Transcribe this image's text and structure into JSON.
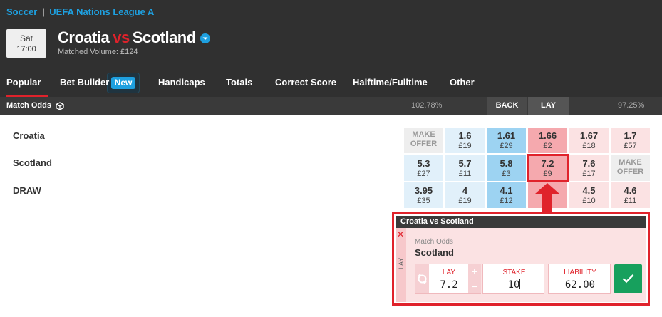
{
  "breadcrumb": {
    "sport": "Soccer",
    "separator": "|",
    "competition": "UEFA Nations League A"
  },
  "event": {
    "day": "Sat",
    "time": "17:00",
    "home": "Croatia",
    "vs": "vs",
    "away": "Scotland",
    "matched_volume": "Matched Volume: £124"
  },
  "tabs": [
    {
      "label": "Popular",
      "active": true
    },
    {
      "label": "Bet Builder"
    },
    {
      "label": "Handicaps"
    },
    {
      "label": "Totals"
    },
    {
      "label": "Correct Score"
    },
    {
      "label": "Halftime/Fulltime"
    },
    {
      "label": "Other"
    }
  ],
  "new_badge": "New",
  "market": {
    "name": "Match Odds",
    "back_overround": "102.78%",
    "back_label": "BACK",
    "lay_label": "LAY",
    "lay_overround": "97.25%"
  },
  "runners": [
    {
      "name": "Croatia",
      "prices": [
        {
          "type": "offer",
          "label1": "MAKE",
          "label2": "OFFER"
        },
        {
          "type": "back-lt",
          "odds": "1.6",
          "amount": "£19"
        },
        {
          "type": "back",
          "odds": "1.61",
          "amount": "£29"
        },
        {
          "type": "lay",
          "odds": "1.66",
          "amount": "£2"
        },
        {
          "type": "lay-lt",
          "odds": "1.67",
          "amount": "£18"
        },
        {
          "type": "lay-lt",
          "odds": "1.7",
          "amount": "£57"
        }
      ]
    },
    {
      "name": "Scotland",
      "prices": [
        {
          "type": "back-lt",
          "odds": "5.3",
          "amount": "£27"
        },
        {
          "type": "back-lt",
          "odds": "5.7",
          "amount": "£11"
        },
        {
          "type": "back",
          "odds": "5.8",
          "amount": "£3"
        },
        {
          "type": "lay",
          "odds": "7.2",
          "amount": "£9"
        },
        {
          "type": "lay-lt",
          "odds": "7.6",
          "amount": "£17"
        },
        {
          "type": "offer",
          "label1": "MAKE",
          "label2": "OFFER"
        }
      ]
    },
    {
      "name": "DRAW",
      "prices": [
        {
          "type": "back-lt",
          "odds": "3.95",
          "amount": "£35"
        },
        {
          "type": "back-lt",
          "odds": "4",
          "amount": "£19"
        },
        {
          "type": "back",
          "odds": "4.1",
          "amount": "£12"
        },
        {
          "type": "lay",
          "odds": "",
          "amount": ""
        },
        {
          "type": "lay-lt",
          "odds": "4.5",
          "amount": "£10"
        },
        {
          "type": "lay-lt",
          "odds": "4.6",
          "amount": "£11"
        }
      ]
    }
  ],
  "betslip": {
    "title": "Croatia vs Scotland",
    "close": "✕",
    "side": "LAY",
    "market": "Match Odds",
    "selection": "Scotland",
    "odds_label": "LAY",
    "odds_value": "7.2",
    "plus": "+",
    "minus": "−",
    "stake_label": "STAKE",
    "stake_value": "10",
    "liability_label": "LIABILITY",
    "liability_value": "62.00"
  },
  "colors": {
    "accent_blue": "#1ea0e0",
    "brand_red": "#e0222b",
    "back": "#9dd3f2",
    "lay": "#f5a9ae",
    "confirm_green": "#17a05d"
  }
}
